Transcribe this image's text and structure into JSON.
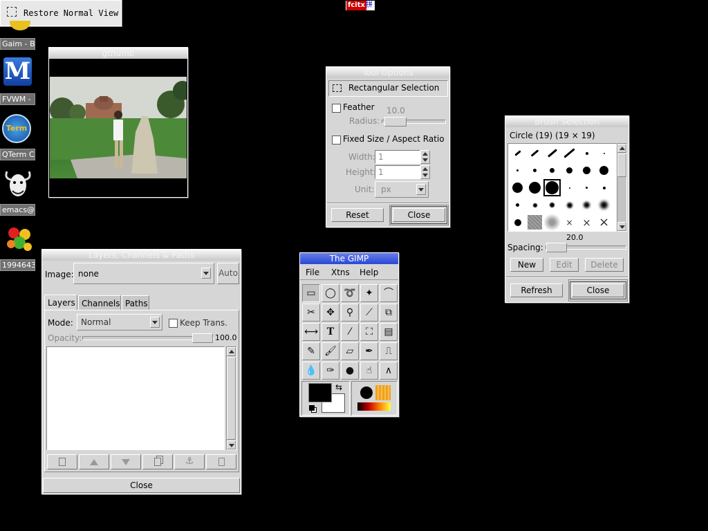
{
  "restore_button": {
    "label": "Restore Normal View"
  },
  "fcitx": {
    "label": "fcitx",
    "glyph": "拼"
  },
  "desktop_icons": [
    {
      "label": "Gaim - Bu"
    },
    {
      "label": "FVWM - ",
      "letter": "M"
    },
    {
      "label": "QTerm C",
      "letter": "Term"
    },
    {
      "label": "emacs@t"
    },
    {
      "label": "1994643"
    }
  ],
  "gthumb": {
    "title": "gthumb"
  },
  "tool_options": {
    "title": "Tool Options",
    "tool_name": "Rectangular Selection",
    "feather_label": "Feather",
    "radius_value": "10.0",
    "radius_label": "Radius:",
    "fixed_label": "Fixed Size / Aspect Ratio",
    "width_label": "Width:",
    "width_value": "1",
    "height_label": "Height:",
    "height_value": "1",
    "unit_label": "Unit:",
    "unit_value": "px",
    "reset_label": "Reset",
    "close_label": "Close"
  },
  "brush_selection": {
    "title": "Brush Selection",
    "brush_name": "Circle (19)  (19 × 19)",
    "spacing_value": "20.0",
    "spacing_label": "Spacing:",
    "new_label": "New",
    "edit_label": "Edit",
    "delete_label": "Delete",
    "refresh_label": "Refresh",
    "close_label": "Close"
  },
  "layers": {
    "title": "Layers, Channels & Paths",
    "image_label": "Image:",
    "image_value": "none",
    "auto_label": "Auto",
    "tabs": [
      "Layers",
      "Channels",
      "Paths"
    ],
    "mode_label": "Mode:",
    "mode_value": "Normal",
    "keep_trans_label": "Keep Trans.",
    "opacity_label": "Opacity:",
    "opacity_value": "100.0",
    "close_label": "Close"
  },
  "gimp": {
    "title": "The GIMP",
    "menu": [
      "File",
      "Xtns",
      "Help"
    ]
  },
  "colors": {
    "titlebar_active": "#2848d8",
    "window_bg": "#d6d6d6",
    "desktop_bg": "#000000"
  }
}
